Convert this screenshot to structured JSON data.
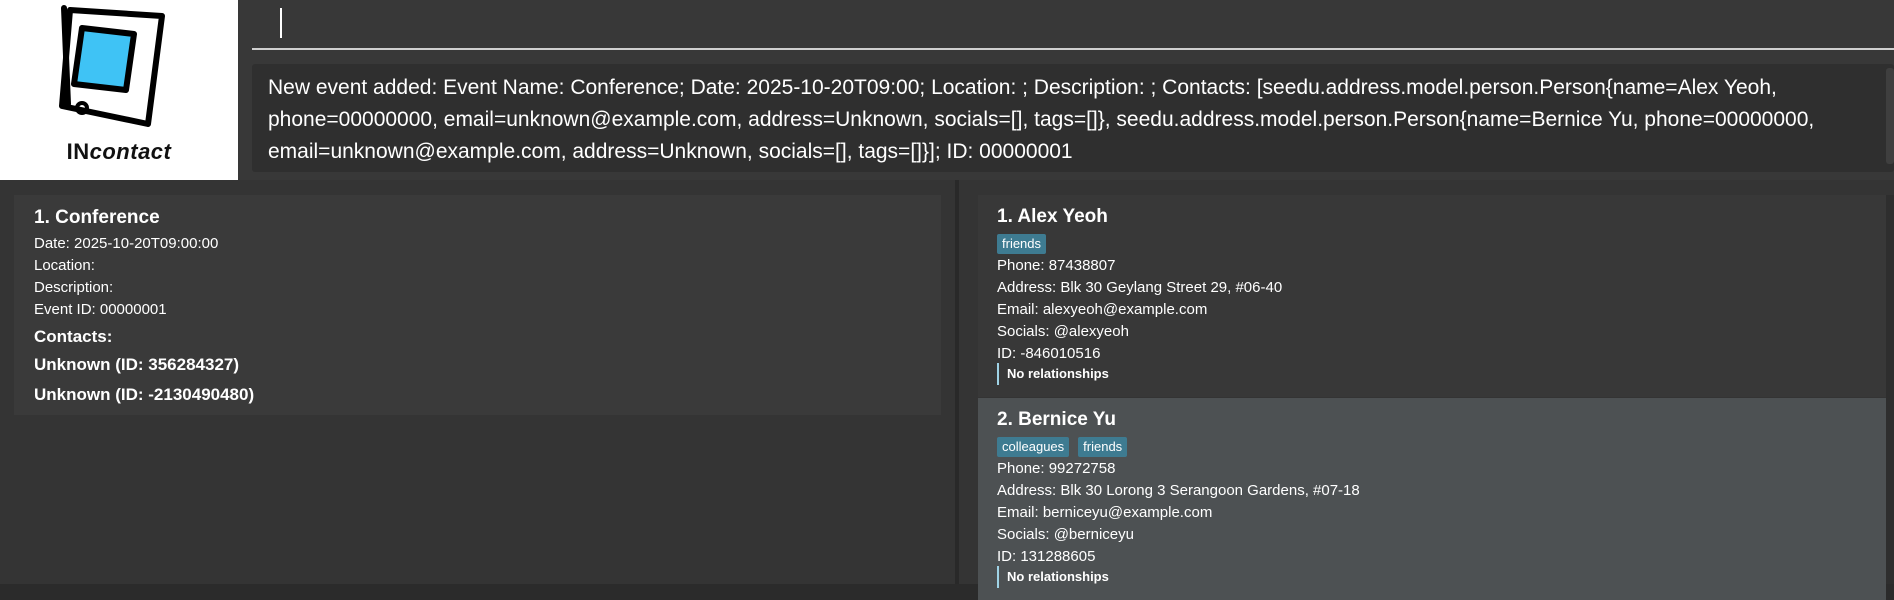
{
  "app": {
    "logo_prefix": "IN",
    "logo_suffix": "contact"
  },
  "command": {
    "value": ""
  },
  "result": {
    "text": "New event added: Event Name: Conference; Date: 2025-10-20T09:00; Location: ; Description: ; Contacts: [seedu.address.model.person.Person{name=Alex Yeoh, phone=00000000, email=unknown@example.com, address=Unknown, socials=[], tags=[]}, seedu.address.model.person.Person{name=Bernice Yu, phone=00000000, email=unknown@example.com, address=Unknown, socials=[], tags=[]}]; ID: 00000001"
  },
  "events": [
    {
      "title": "1.  Conference",
      "date": "Date: 2025-10-20T09:00:00",
      "location": "Location:",
      "description": "Description:",
      "event_id": "Event ID: 00000001",
      "contacts_label": "Contacts:",
      "contacts": [
        "Unknown (ID: 356284327)",
        "Unknown (ID: -2130490480)"
      ]
    }
  ],
  "persons": [
    {
      "title": "1. Alex Yeoh",
      "tags": [
        "friends"
      ],
      "phone": "Phone: 87438807",
      "address": "Address: Blk 30 Geylang Street 29, #06-40",
      "email": "Email: alexyeoh@example.com",
      "socials": "Socials: @alexyeoh",
      "id": "ID: -846010516",
      "relationships": "No relationships"
    },
    {
      "title": "2. Bernice Yu",
      "tags": [
        "colleagues",
        "friends"
      ],
      "phone": "Phone: 99272758",
      "address": "Address: Blk 30 Lorong 3 Serangoon Gardens, #07-18",
      "email": "Email: berniceyu@example.com",
      "socials": "Socials: @berniceyu",
      "id": "ID: 131288605",
      "relationships": "No relationships"
    }
  ],
  "colors": {
    "tag": "#3e7b91",
    "selected_card": "#4d5153",
    "logo_screen": "#3fc3f5"
  }
}
